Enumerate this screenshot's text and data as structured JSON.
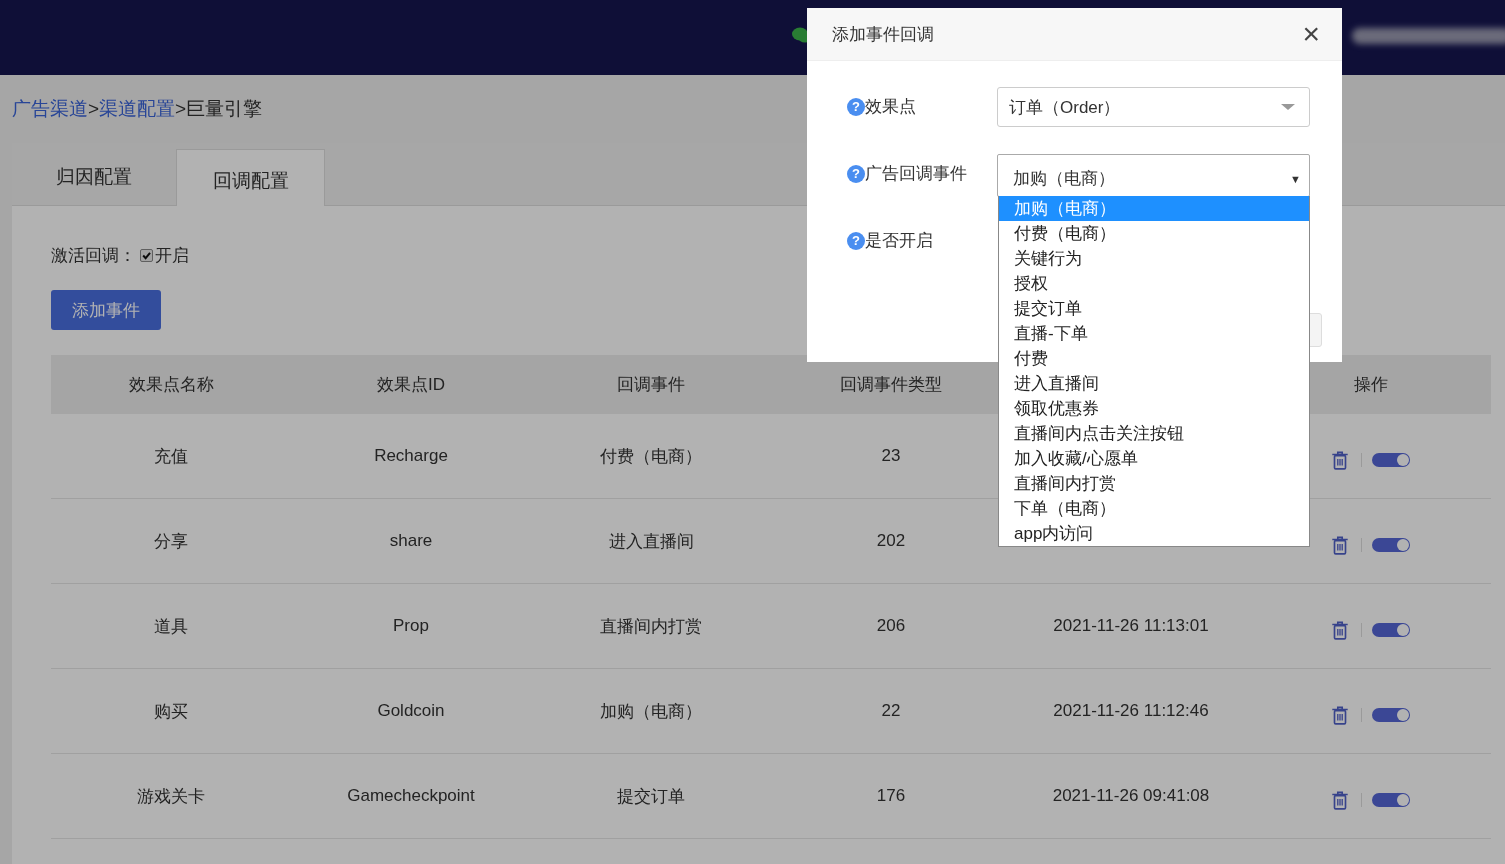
{
  "breadcrumb": {
    "separator": ">",
    "items": [
      {
        "label": "广告渠道",
        "link": true
      },
      {
        "label": "渠道配置",
        "link": true
      },
      {
        "label": "巨量引擎",
        "link": false
      }
    ]
  },
  "tabs": [
    {
      "label": "归因配置",
      "selected": false
    },
    {
      "label": "回调配置",
      "selected": true
    }
  ],
  "activation": {
    "label": "激活回调：",
    "option": "开启",
    "checked": true
  },
  "add_button": "添加事件",
  "table": {
    "columns": [
      {
        "label": "效果点名称"
      },
      {
        "label": "效果点ID"
      },
      {
        "label": "回调事件"
      },
      {
        "label": "回调事件类型"
      },
      {},
      {
        "label": "操作"
      }
    ],
    "rows": [
      {
        "name": "充值",
        "id": "Recharge",
        "event": "付费（电商）",
        "event_type": "23",
        "on": true
      },
      {
        "name": "分享",
        "id": "share",
        "event": "进入直播间",
        "event_type": "202",
        "on": true
      },
      {
        "name": "道具",
        "id": "Prop",
        "event": "直播间内打赏",
        "event_type": "206",
        "time": "2021-11-26 11:13:01",
        "on": true
      },
      {
        "name": "购买",
        "id": "Goldcoin",
        "event": "加购（电商）",
        "event_type": "22",
        "time": "2021-11-26 11:12:46",
        "on": true
      },
      {
        "name": "游戏关卡",
        "id": "Gamecheckpoint",
        "event": "提交订单",
        "event_type": "176",
        "time": "2021-11-26 09:41:08",
        "on": true
      }
    ]
  },
  "dialog": {
    "title": "添加事件回调",
    "close": "×",
    "fields": [
      {
        "kind": "select",
        "help": "?",
        "label": "效果点",
        "value": "订单（Order）"
      },
      {
        "kind": "native-select",
        "help": "?",
        "label": "广告回调事件",
        "value": "加购（电商）",
        "caret": "▼",
        "expanded": true,
        "options": [
          {
            "label": "加购（电商）",
            "selected": true
          },
          {
            "label": "付费（电商）",
            "selected": false
          },
          {
            "label": "关键行为",
            "selected": false
          },
          {
            "label": "授权",
            "selected": false
          },
          {
            "label": "提交订单",
            "selected": false
          },
          {
            "label": "直播-下单",
            "selected": false
          },
          {
            "label": "付费",
            "selected": false
          },
          {
            "label": "进入直播间",
            "selected": false
          },
          {
            "label": "领取优惠券",
            "selected": false
          },
          {
            "label": "直播间内点击关注按钮",
            "selected": false
          },
          {
            "label": "加入收藏/心愿单",
            "selected": false
          },
          {
            "label": "直播间内打赏",
            "selected": false
          },
          {
            "label": "下单（电商）",
            "selected": false
          },
          {
            "label": "app内访问",
            "selected": false
          }
        ]
      },
      {
        "kind": "toggle",
        "help": "?",
        "label": "是否开启"
      }
    ]
  }
}
